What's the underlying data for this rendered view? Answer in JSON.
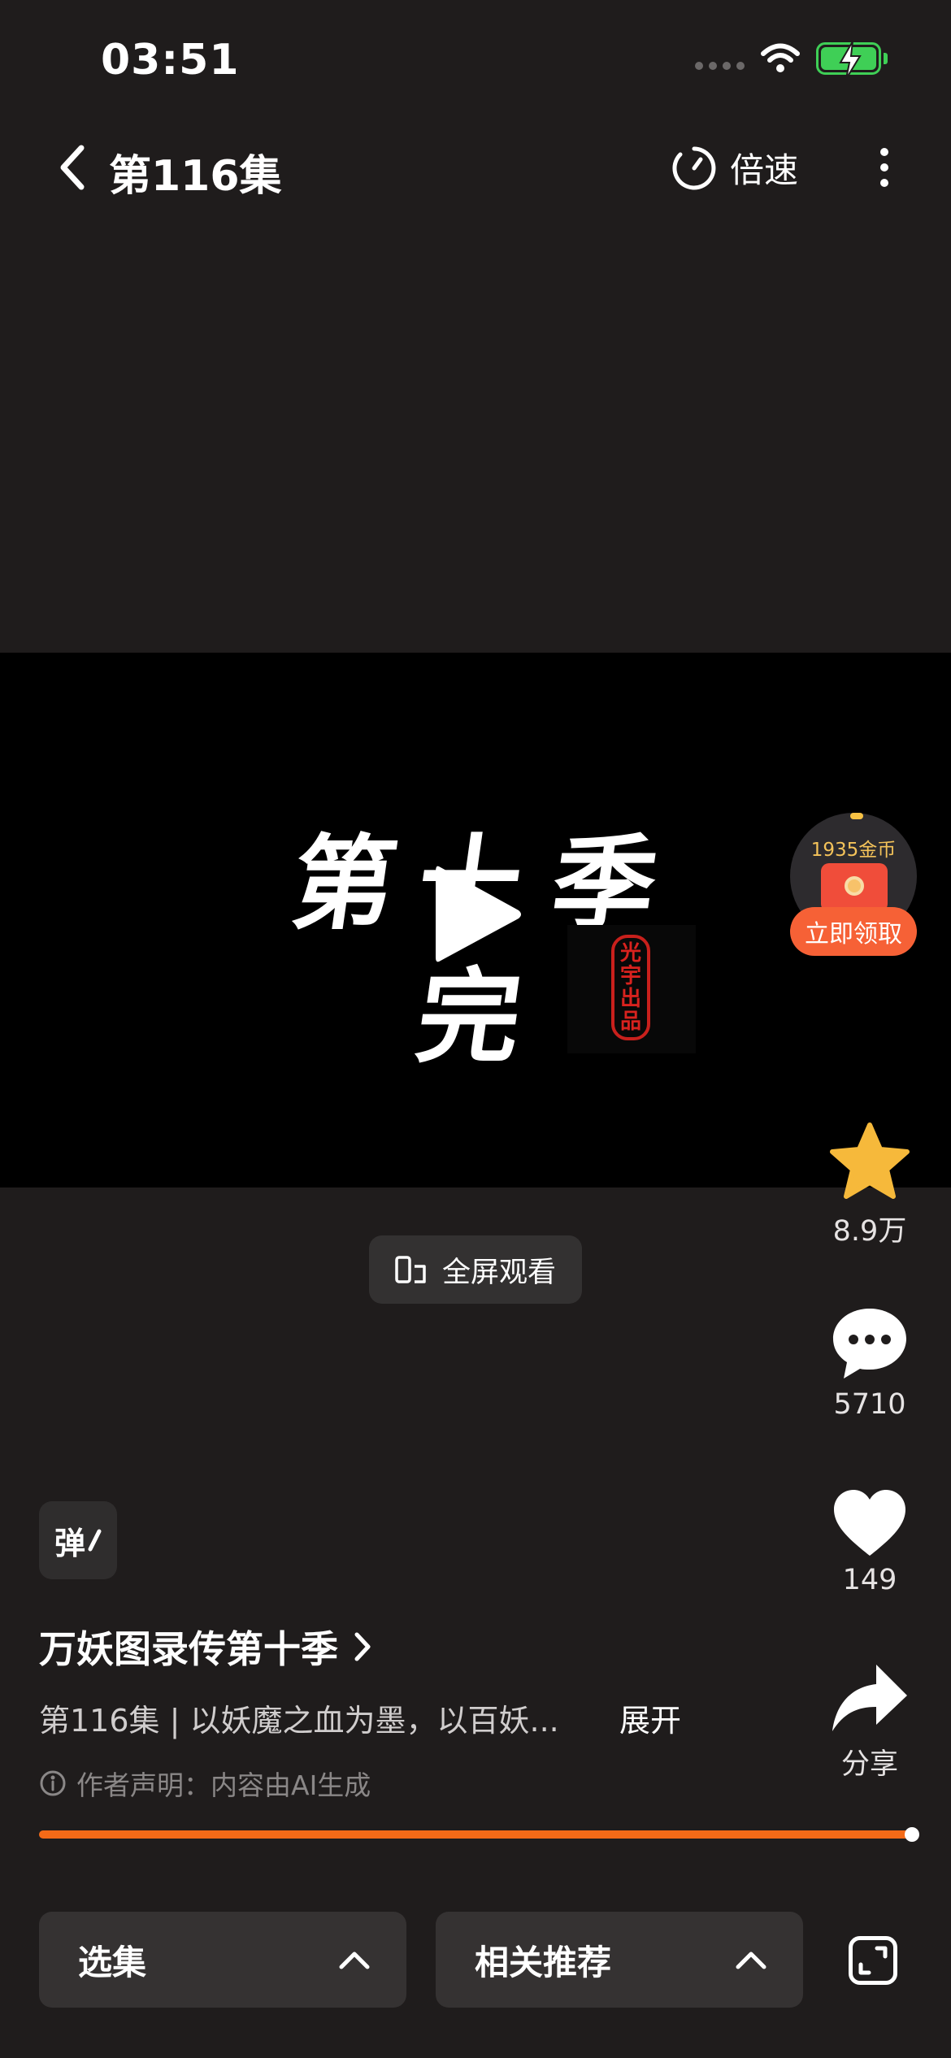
{
  "status_bar": {
    "time": "03:51"
  },
  "nav": {
    "title": "第116集",
    "speed_label": "倍速"
  },
  "video": {
    "title_chars": [
      "第",
      "十",
      "季",
      "完"
    ],
    "seal_text": [
      "光",
      "宇",
      "出",
      "品"
    ]
  },
  "coin_widget": {
    "amount": "1935金币",
    "claim_label": "立即领取"
  },
  "fullscreen_label": "全屏观看",
  "actions": {
    "favorite": {
      "count": "8.9万",
      "icon": "star-icon",
      "color": "#f6b93b"
    },
    "comment": {
      "count": "5710",
      "icon": "comment-icon"
    },
    "like": {
      "count": "149",
      "icon": "heart-icon"
    },
    "share": {
      "label": "分享",
      "icon": "share-icon"
    }
  },
  "danmaku_label": "弹",
  "info": {
    "drama_title": "万妖图录传第十季",
    "episode_desc": "第116集 | 以妖魔之血为墨，以百妖...",
    "expand_label": "展开",
    "disclaimer": "作者声明：内容由AI生成"
  },
  "progress": {
    "fraction": 0.995,
    "color": "#f46a17"
  },
  "bottom": {
    "select_episode_label": "选集",
    "related_label": "相关推荐"
  }
}
